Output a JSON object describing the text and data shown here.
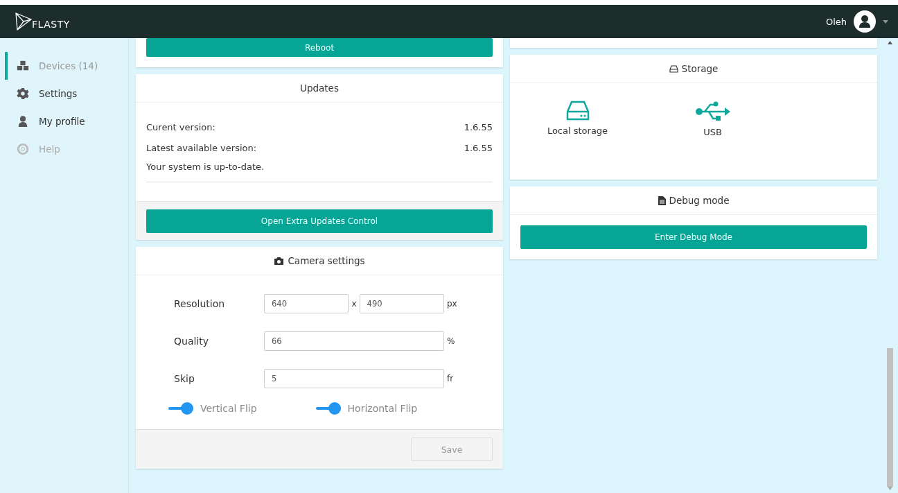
{
  "app": {
    "logo": "FLASTY",
    "user": "Oleh"
  },
  "sidebar": {
    "items": [
      {
        "label": "Devices (14)",
        "kind": "cubes",
        "selected": true,
        "disabled": false
      },
      {
        "label": "Settings",
        "kind": "gear",
        "selected": false,
        "disabled": false
      },
      {
        "label": "My profile",
        "kind": "profile",
        "selected": false,
        "disabled": false
      },
      {
        "label": "Help",
        "kind": "help",
        "selected": false,
        "disabled": true
      }
    ]
  },
  "reboot_card": {
    "button": "Reboot"
  },
  "updates": {
    "title": "Updates",
    "rows": [
      {
        "label": "Curent version:",
        "value": "1.6.55"
      },
      {
        "label": "Latest available version:",
        "value": "1.6.55"
      }
    ],
    "status": "Your system is up-to-date.",
    "button": "Open Extra Updates Control"
  },
  "camera": {
    "title": "Camera settings",
    "fields": [
      {
        "label": "Resolution",
        "values": [
          "640",
          "490"
        ],
        "separator": "x",
        "unit": "px"
      },
      {
        "label": "Quality",
        "values": [
          "66"
        ],
        "unit": "%"
      },
      {
        "label": "Skip",
        "values": [
          "5"
        ],
        "unit": "fr"
      }
    ],
    "toggles": [
      {
        "label": "Vertical Flip",
        "on": true
      },
      {
        "label": "Horizontal Flip",
        "on": true
      }
    ],
    "save": {
      "label": "Save",
      "disabled": true
    }
  },
  "storage": {
    "title": "Storage",
    "items": [
      {
        "label": "Local storage",
        "kind": "local"
      },
      {
        "label": "USB",
        "kind": "usb"
      }
    ]
  },
  "debug": {
    "title": "Debug mode",
    "button": "Enter Debug Mode"
  }
}
